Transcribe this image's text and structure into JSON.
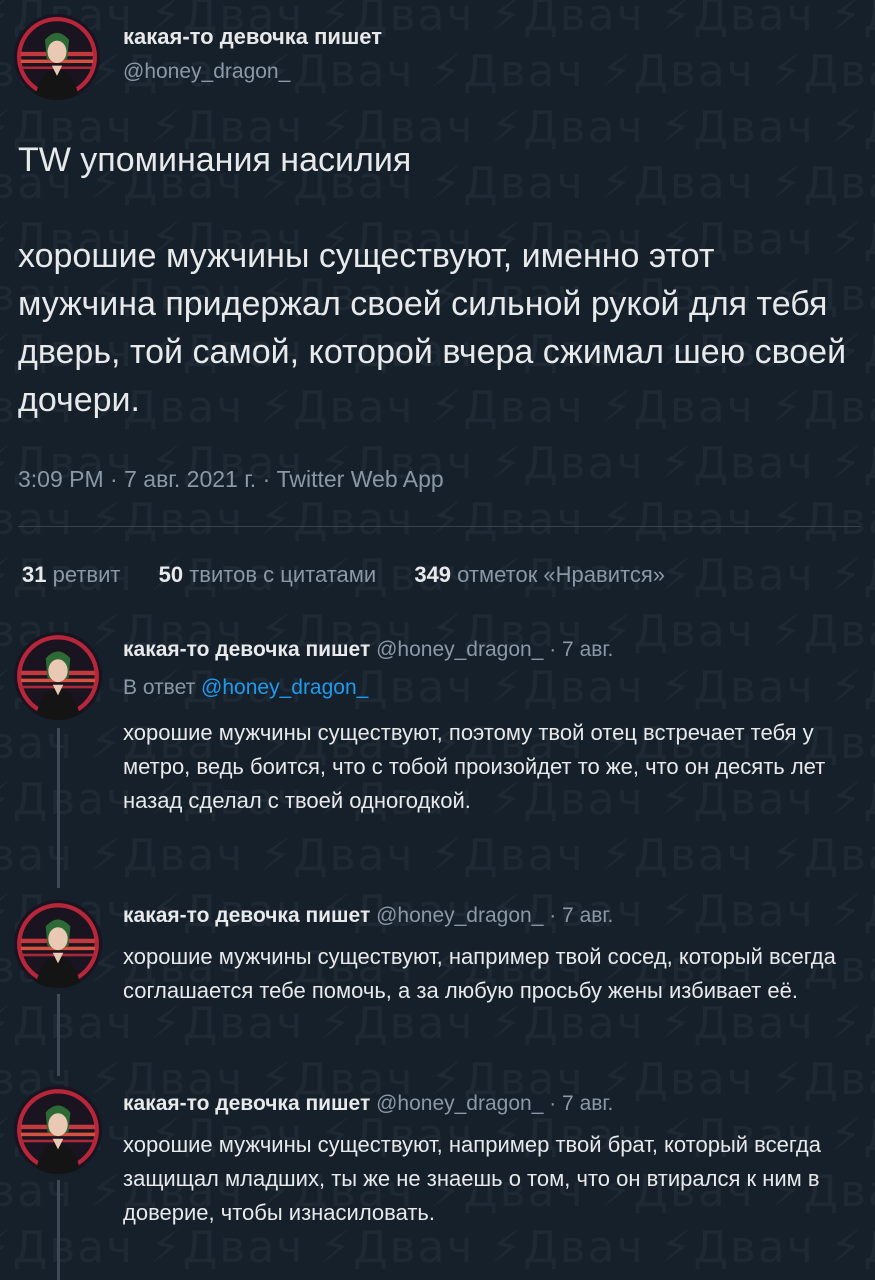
{
  "theme": {
    "background": "#15202b",
    "text": "#e7e9ea",
    "secondary": "#8b98a5",
    "link": "#1d9bf0",
    "divider": "#38444d"
  },
  "watermark": {
    "text": "Двач",
    "icon": "lightning-icon"
  },
  "main_tweet": {
    "author_name": "какая-то девочка пишет",
    "handle": "@honey_dragon_",
    "text_lines": [
      "TW упоминания насилия",
      "хорошие мужчины существуют, именно этот мужчина придержал своей сильной рукой для тебя дверь, той самой, которой вчера сжимал шею своей дочери."
    ],
    "meta": "3:09 PM · 7 авг. 2021 г. · Twitter Web App",
    "stats": {
      "retweets_count": "31",
      "retweets_label": "ретвит",
      "quotes_count": "50",
      "quotes_label": "твитов с цитатами",
      "likes_count": "349",
      "likes_label": "отметок «Нравится»"
    }
  },
  "replies": [
    {
      "author_name": "какая-то девочка пишет",
      "handle": "@honey_dragon_",
      "date": "· 7 авг.",
      "in_reply_prefix": "В ответ",
      "in_reply_handle": "@honey_dragon_",
      "text": "хорошие мужчины существуют, поэтому твой отец встречает тебя у метро, ведь боится, что с тобой произойдет то же, что он десять лет назад сделал с твоей одногодкой."
    },
    {
      "author_name": "какая-то девочка пишет",
      "handle": "@honey_dragon_",
      "date": "· 7 авг.",
      "text": "хорошие мужчины существуют, например твой сосед, который всегда соглашается тебе помочь, а за любую просьбу жены избивает её."
    },
    {
      "author_name": "какая-то девочка пишет",
      "handle": "@honey_dragon_",
      "date": "· 7 авг.",
      "text": "хорошие мужчины существуют, например твой брат, который всегда защищал младших, ты же не знаешь о том, что он втирался к ним в доверие, чтобы изнасиловать."
    }
  ]
}
